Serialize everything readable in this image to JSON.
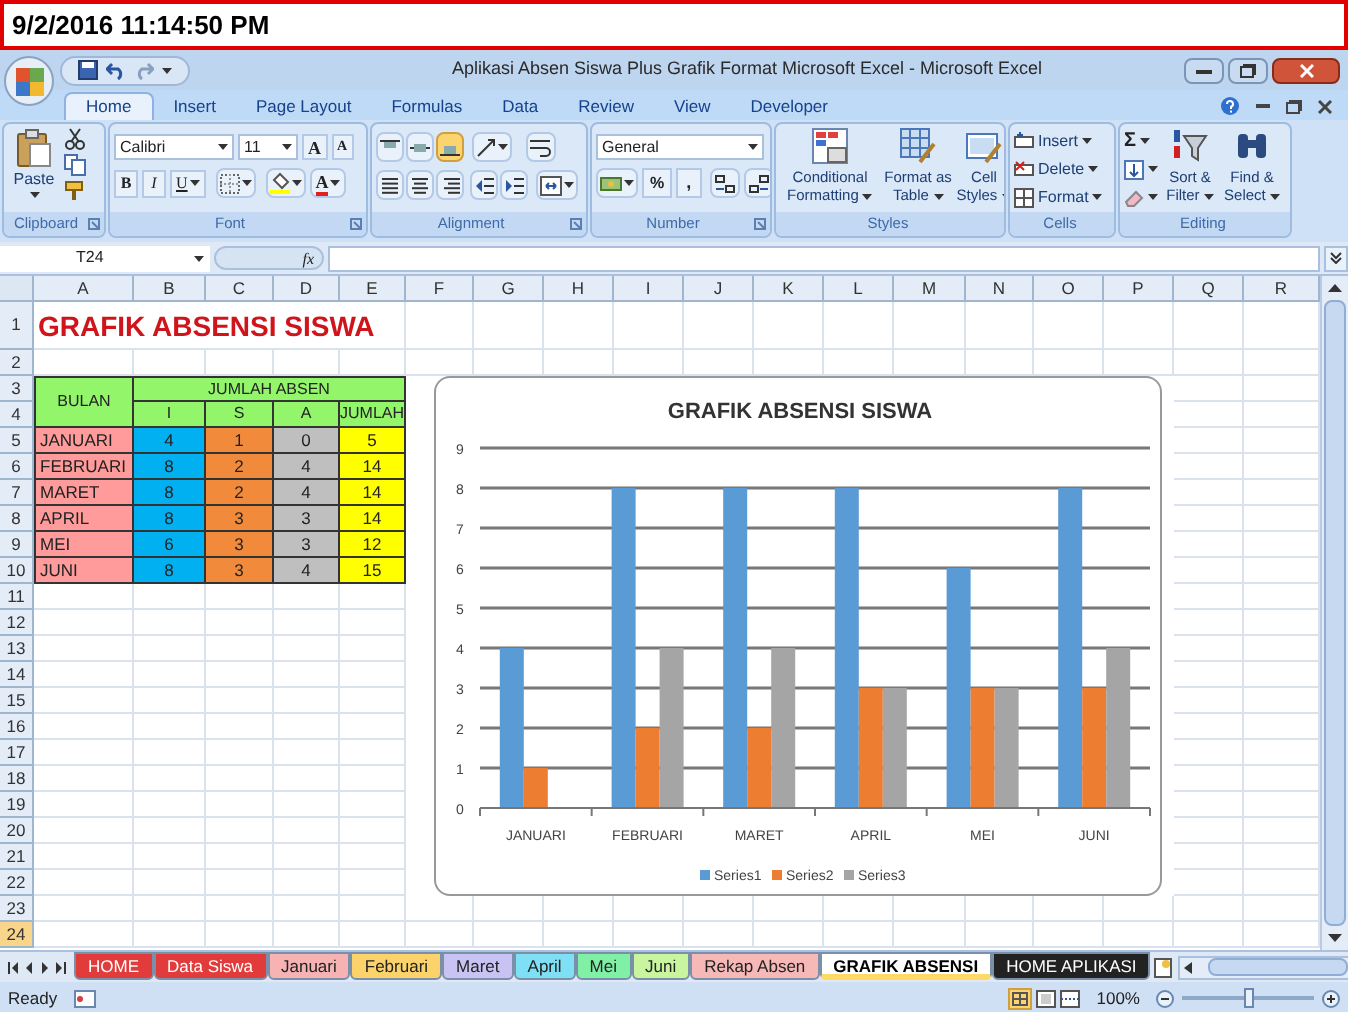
{
  "clock": "9/2/2016 11:14:50 PM",
  "window": {
    "title": "Aplikasi Absen Siswa Plus Grafik Format Microsoft Excel - Microsoft Excel"
  },
  "ribbon_tabs": [
    {
      "label": "Home",
      "selected": true
    },
    {
      "label": "Insert",
      "selected": false
    },
    {
      "label": "Page Layout",
      "selected": false
    },
    {
      "label": "Formulas",
      "selected": false
    },
    {
      "label": "Data",
      "selected": false
    },
    {
      "label": "Review",
      "selected": false
    },
    {
      "label": "View",
      "selected": false
    },
    {
      "label": "Developer",
      "selected": false
    }
  ],
  "ribbon": {
    "clipboard": {
      "label": "Clipboard",
      "paste": "Paste"
    },
    "font": {
      "label": "Font",
      "name": "Calibri",
      "size": "11",
      "grow": "A",
      "shrink": "A",
      "bold": "B",
      "italic": "I",
      "underline": "U",
      "color_button": "A"
    },
    "alignment": {
      "label": "Alignment"
    },
    "number": {
      "label": "Number",
      "format": "General",
      "percent": "%",
      "comma": ","
    },
    "styles": {
      "label": "Styles",
      "conditional": "Conditional Formatting",
      "table": "Format as Table",
      "cell": "Cell Styles"
    },
    "cells": {
      "label": "Cells",
      "insert": "Insert",
      "delete": "Delete",
      "format": "Format"
    },
    "editing": {
      "label": "Editing",
      "sum": "Σ",
      "sort": "Sort & Filter",
      "find": "Find & Select"
    }
  },
  "formula_bar": {
    "name_box": "T24",
    "function_label": "fx"
  },
  "columns": [
    "A",
    "B",
    "C",
    "D",
    "E",
    "F",
    "G",
    "H",
    "I",
    "J",
    "K",
    "L",
    "M",
    "N",
    "O",
    "P",
    "Q",
    "R"
  ],
  "rows": [
    {
      "label": "1",
      "selected": false
    },
    {
      "label": "2",
      "selected": false
    },
    {
      "label": "3",
      "selected": false
    },
    {
      "label": "4",
      "selected": false
    },
    {
      "label": "5",
      "selected": false
    },
    {
      "label": "6",
      "selected": false
    },
    {
      "label": "7",
      "selected": false
    },
    {
      "label": "8",
      "selected": false
    },
    {
      "label": "9",
      "selected": false
    },
    {
      "label": "10",
      "selected": false
    },
    {
      "label": "11",
      "selected": false
    },
    {
      "label": "12",
      "selected": false
    },
    {
      "label": "13",
      "selected": false
    },
    {
      "label": "14",
      "selected": false
    },
    {
      "label": "15",
      "selected": false
    },
    {
      "label": "16",
      "selected": false
    },
    {
      "label": "17",
      "selected": false
    },
    {
      "label": "18",
      "selected": false
    },
    {
      "label": "19",
      "selected": false
    },
    {
      "label": "20",
      "selected": false
    },
    {
      "label": "21",
      "selected": false
    },
    {
      "label": "22",
      "selected": false
    },
    {
      "label": "23",
      "selected": false
    },
    {
      "label": "24",
      "selected": true
    }
  ],
  "sheet": {
    "title": "GRAFIK ABSENSI SISWA",
    "table": {
      "month_header": "BULAN",
      "group_header": "JUMLAH ABSEN",
      "subheaders": [
        "I",
        "S",
        "A",
        "JUMLAH"
      ],
      "rows": [
        {
          "month": "JANUARI",
          "values": [
            "4",
            "1",
            "0",
            "5"
          ]
        },
        {
          "month": "FEBRUARI",
          "values": [
            "8",
            "2",
            "4",
            "14"
          ]
        },
        {
          "month": "MARET",
          "values": [
            "8",
            "2",
            "4",
            "14"
          ]
        },
        {
          "month": "APRIL",
          "values": [
            "8",
            "3",
            "3",
            "14"
          ]
        },
        {
          "month": "MEI",
          "values": [
            "6",
            "3",
            "3",
            "12"
          ]
        },
        {
          "month": "JUNI",
          "values": [
            "8",
            "3",
            "4",
            "15"
          ]
        }
      ]
    }
  },
  "chart": {
    "chart_data": {
      "type": "bar",
      "title": "GRAFIK ABSENSI SISWA",
      "categories": [
        "JANUARI",
        "FEBRUARI",
        "MARET",
        "APRIL",
        "MEI",
        "JUNI"
      ],
      "series": [
        {
          "name": "Series1",
          "color": "#5b9bd5",
          "values": [
            4,
            8,
            8,
            8,
            6,
            8
          ]
        },
        {
          "name": "Series2",
          "color": "#ed7d31",
          "values": [
            1,
            2,
            2,
            3,
            3,
            3
          ]
        },
        {
          "name": "Series3",
          "color": "#a5a5a5",
          "values": [
            0,
            4,
            4,
            3,
            3,
            4
          ]
        }
      ],
      "ylim": [
        0,
        9
      ],
      "yticks": [
        {
          "value": 0,
          "label": "0"
        },
        {
          "value": 1,
          "label": "1"
        },
        {
          "value": 2,
          "label": "2"
        },
        {
          "value": 3,
          "label": "3"
        },
        {
          "value": 4,
          "label": "4"
        },
        {
          "value": 5,
          "label": "5"
        },
        {
          "value": 6,
          "label": "6"
        },
        {
          "value": 7,
          "label": "7"
        },
        {
          "value": 8,
          "label": "8"
        },
        {
          "value": 9,
          "label": "9"
        }
      ],
      "grid": true,
      "legend": true
    }
  },
  "sheet_tabs": [
    {
      "label": "HOME",
      "color": "#e23b3b",
      "selected": false
    },
    {
      "label": "Data Siswa",
      "color": "#e23b3b",
      "selected": false
    },
    {
      "label": "Januari",
      "color": "#f7b3b3",
      "selected": false
    },
    {
      "label": "Februari",
      "color": "#fbd36a",
      "selected": false
    },
    {
      "label": "Maret",
      "color": "#c8c3f2",
      "selected": false
    },
    {
      "label": "April",
      "color": "#7fdff4",
      "selected": false
    },
    {
      "label": "Mei",
      "color": "#7ff0a6",
      "selected": false
    },
    {
      "label": "Juni",
      "color": "#c9f59f",
      "selected": false
    },
    {
      "label": "Rekap Absen",
      "color": "#f7b8b8",
      "selected": false
    },
    {
      "label": "GRAFIK ABSENSI",
      "color": "#ffd966",
      "selected": true
    },
    {
      "label": "HOME APLIKASI",
      "color": "#222222",
      "selected": false
    }
  ],
  "status_bar": {
    "status": "Ready",
    "zoom": "100%",
    "zoom_slider": {
      "level": 0.5
    }
  }
}
